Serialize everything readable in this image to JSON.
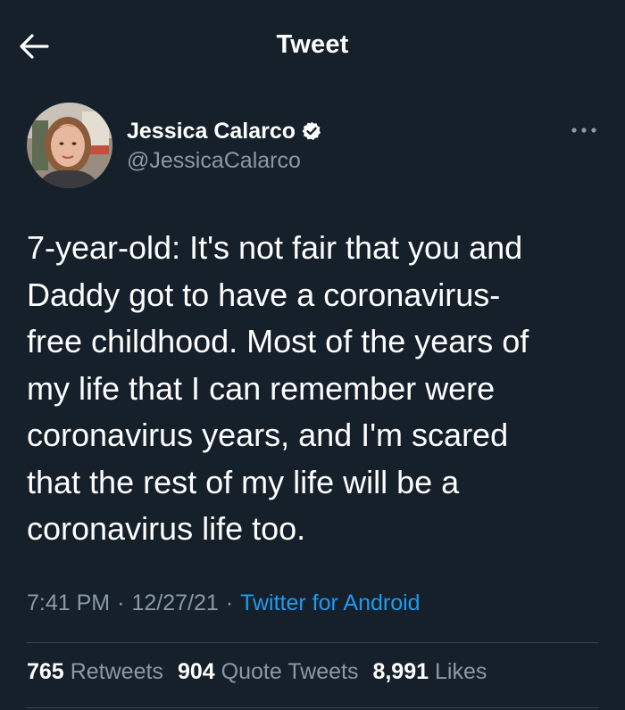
{
  "header": {
    "title": "Tweet",
    "back_icon": "arrow-left-icon"
  },
  "author": {
    "name": "Jessica Calarco",
    "handle": "@JessicaCalarco",
    "verified": true,
    "verified_icon": "verified-badge-icon",
    "avatar": "avatar"
  },
  "more_icon": "more-dots-icon",
  "tweet": {
    "text": "7-year-old: It's not fair that you and\nDaddy got to have a coronavirus-\nfree childhood. Most of the years of\nmy life that I can remember were\ncoronavirus years, and I'm scared\nthat the rest of my life will be a\ncoronavirus life too."
  },
  "meta": {
    "time": "7:41 PM",
    "separator": "·",
    "date": "12/27/21",
    "source": "Twitter for Android"
  },
  "stats": {
    "retweets_count": "765",
    "retweets_label": "Retweets",
    "quotes_count": "904",
    "quotes_label": "Quote Tweets",
    "likes_count": "8,991",
    "likes_label": "Likes"
  },
  "colors": {
    "background": "#15202b",
    "text": "#ffffff",
    "secondary": "#8b98a5",
    "accent": "#1d9bf0",
    "divider": "#38444d"
  }
}
